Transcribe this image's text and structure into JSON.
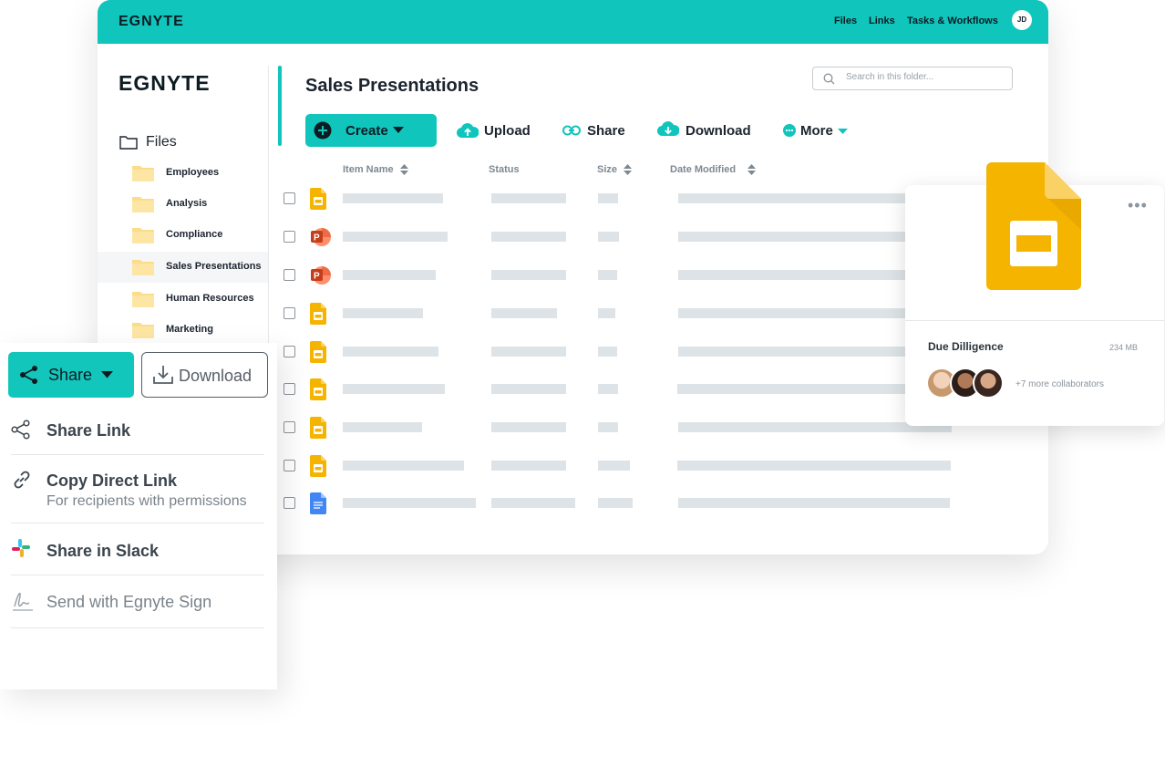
{
  "topbar": {
    "logo": "EGNYTE",
    "nav": [
      "Files",
      "Links",
      "Tasks & Workflows"
    ],
    "avatar_initials": "JD"
  },
  "sidebar": {
    "logo": "EGNYTE",
    "files_label": "Files",
    "folders": [
      {
        "label": "Employees",
        "active": false
      },
      {
        "label": "Analysis",
        "active": false
      },
      {
        "label": "Compliance",
        "active": false
      },
      {
        "label": "Sales Presentations",
        "active": true
      },
      {
        "label": "Human Resources",
        "active": false
      },
      {
        "label": "Marketing",
        "active": false
      }
    ]
  },
  "main": {
    "title": "Sales Presentations",
    "search_placeholder": "Search in this folder...",
    "toolbar": {
      "create": "Create",
      "upload": "Upload",
      "share": "Share",
      "download": "Download",
      "more": "More"
    },
    "columns": [
      "Item Name",
      "Status",
      "Size",
      "Date Modified"
    ],
    "rows": [
      {
        "icon": "google-slides-icon"
      },
      {
        "icon": "powerpoint-icon"
      },
      {
        "icon": "powerpoint-icon"
      },
      {
        "icon": "google-slides-icon"
      },
      {
        "icon": "google-slides-icon"
      },
      {
        "icon": "google-slides-icon"
      },
      {
        "icon": "google-slides-icon"
      },
      {
        "icon": "google-slides-icon"
      },
      {
        "icon": "google-docs-icon"
      }
    ]
  },
  "file_card": {
    "name": "Due Dilligence",
    "size": "234 MB",
    "collaborators_text": "+7 more collaborators",
    "menu": "•••"
  },
  "share_menu": {
    "share_button": "Share",
    "download_button": "Download",
    "items": [
      {
        "label": "Share Link",
        "sub": ""
      },
      {
        "label": "Copy Direct Link",
        "sub": "For recipients with permissions"
      },
      {
        "label": "Share in Slack",
        "sub": ""
      },
      {
        "label": "Send with Egnyte Sign",
        "sub": ""
      }
    ]
  },
  "colors": {
    "brand_teal": "#0fc5bc",
    "slides_yellow": "#f4b400",
    "powerpoint_red": "#d24625",
    "docs_blue": "#4285f4",
    "placeholder_gray": "#dde3e6"
  }
}
